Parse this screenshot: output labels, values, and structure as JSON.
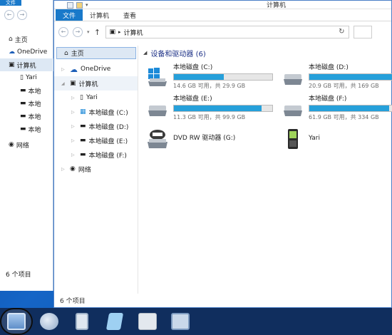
{
  "colors": {
    "accent": "#1979ca",
    "bar_fill": "#26a0da",
    "group_header": "#1e3287",
    "taskbar": "#102e5e"
  },
  "back_window": {
    "file_tab": "文件",
    "items": [
      {
        "label": "主页",
        "icon": "home-icon"
      },
      {
        "label": "OneDrive",
        "icon": "onedrive-cloud-icon"
      },
      {
        "label": "计算机",
        "icon": "computer-icon"
      },
      {
        "label": "Yari",
        "icon": "phone-icon"
      },
      {
        "label": "本地",
        "icon": "disk-icon"
      },
      {
        "label": "本地",
        "icon": "disk-icon"
      },
      {
        "label": "本地",
        "icon": "disk-icon"
      },
      {
        "label": "本地",
        "icon": "disk-icon"
      },
      {
        "label": "网络",
        "icon": "network-icon"
      }
    ],
    "status": "6 个项目"
  },
  "window": {
    "title": "计算机",
    "ribbon_tabs": [
      "文件",
      "计算机",
      "查看"
    ],
    "address": {
      "crumb": "计算机"
    },
    "nav": {
      "home": "主页",
      "onedrive": "OneDrive",
      "computer": "计算机",
      "children": [
        "Yari",
        "本地磁盘 (C:)",
        "本地磁盘 (D:)",
        "本地磁盘 (E:)",
        "本地磁盘 (F:)"
      ],
      "network": "网络"
    },
    "group": {
      "title": "设备和驱动器 (6)"
    },
    "drives": [
      {
        "name": "本地磁盘 (C:)",
        "free": "14.6 GB 可用，共 29.9 GB",
        "used_fraction": 0.51
      },
      {
        "name": "本地磁盘 (D:)",
        "free": "20.9 GB 可用，共 169 GB",
        "used_fraction": 0.88
      },
      {
        "name": "本地磁盘 (E:)",
        "free": "11.3 GB 可用，共 99.9 GB",
        "used_fraction": 0.89
      },
      {
        "name": "本地磁盘 (F:)",
        "free": "61.9 GB 可用，共 334 GB",
        "used_fraction": 0.81
      },
      {
        "name": "DVD RW 驱动器 (G:)"
      },
      {
        "name": "Yari"
      }
    ],
    "status": "6 个项目"
  }
}
